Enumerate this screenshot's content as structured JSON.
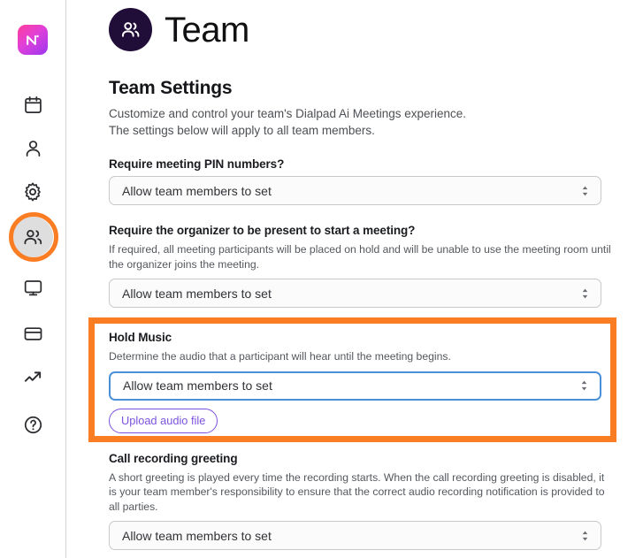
{
  "sidebar": {
    "logo": {
      "name": "dialpad-ai-logo",
      "alt": "Ai"
    },
    "items": [
      {
        "name": "sidebar-item-calendar",
        "icon": "calendar-icon",
        "label": "Calendar",
        "active": false
      },
      {
        "name": "sidebar-item-profile",
        "icon": "person-icon",
        "label": "Profile",
        "active": false
      },
      {
        "name": "sidebar-item-settings",
        "icon": "gear-icon",
        "label": "Settings",
        "active": false
      },
      {
        "name": "sidebar-item-team",
        "icon": "people-icon",
        "label": "Team",
        "active": true
      },
      {
        "name": "sidebar-item-display",
        "icon": "monitor-icon",
        "label": "Display",
        "active": false
      },
      {
        "name": "sidebar-item-billing",
        "icon": "credit-card-icon",
        "label": "Billing",
        "active": false
      },
      {
        "name": "sidebar-item-analytics",
        "icon": "trending-up-icon",
        "label": "Analytics",
        "active": false
      },
      {
        "name": "sidebar-item-help",
        "icon": "help-circle-icon",
        "label": "Help",
        "active": false
      }
    ]
  },
  "header": {
    "avatar_icon": "people-icon",
    "title": "Team"
  },
  "main": {
    "section_title": "Team Settings",
    "intro_line1": "Customize and control your team's Dialpad Ai Meetings experience.",
    "intro_line2": "The settings below will apply to all team members.",
    "fields": {
      "pin": {
        "label": "Require meeting PIN numbers?",
        "value": "Allow team members to set"
      },
      "organizer": {
        "label": "Require the organizer to be present to start a meeting?",
        "description": "If required, all meeting participants will be placed on hold and will be unable to use the meeting room until the organizer joins the meeting.",
        "value": "Allow team members to set"
      },
      "hold_music": {
        "label": "Hold Music",
        "description": "Determine the audio that a participant will hear until the meeting begins.",
        "value": "Allow team members to set",
        "upload_button": "Upload audio file"
      },
      "call_recording": {
        "label": "Call recording greeting",
        "description": "A short greeting is played every time the recording starts. When the call recording greeting is disabled, it is your team member's responsibility to ensure that the correct audio recording notification is provided to all parties.",
        "value": "Allow team members to set"
      }
    }
  },
  "colors": {
    "highlight_orange": "#fa7d24",
    "focus_blue": "#4a90d9",
    "accent_purple": "#7c52e0",
    "avatar_navy": "#200d38"
  }
}
